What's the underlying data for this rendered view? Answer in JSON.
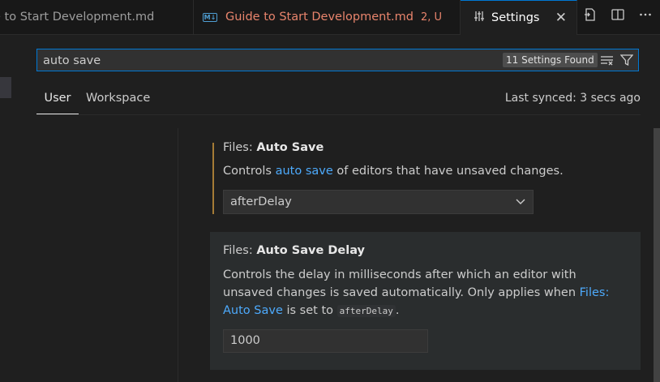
{
  "tabs": [
    {
      "label": "e to Start Development.md"
    },
    {
      "icon": "markdown-icon",
      "icon_text": "M↓",
      "label": "Guide to Start Development.md",
      "badge": "2, U"
    },
    {
      "icon": "settings-sliders-icon",
      "label": "Settings",
      "close": "✕"
    }
  ],
  "search": {
    "value": "auto save",
    "results_badge": "11 Settings Found"
  },
  "scope_tabs": {
    "user": "User",
    "workspace": "Workspace"
  },
  "sync_status": "Last synced: 3 secs ago",
  "settings": [
    {
      "category": "Files: ",
      "name": "Auto Save",
      "desc_pre": "Controls ",
      "desc_link": "auto save",
      "desc_post": " of editors that have unsaved changes.",
      "value": "afterDelay"
    },
    {
      "category": "Files: ",
      "name": "Auto Save Delay",
      "desc_pre": "Controls the delay in milliseconds after which an editor with unsaved changes is saved automatically. Only applies when ",
      "desc_link": "Files: Auto Save",
      "desc_mid": " is set to ",
      "desc_code": "afterDelay",
      "desc_post": ".",
      "value": "1000"
    }
  ],
  "colors": {
    "accent": "#0078d4",
    "link": "#4daafc",
    "modified_tab": "#e8846c",
    "modified_bar": "#a57b36"
  }
}
